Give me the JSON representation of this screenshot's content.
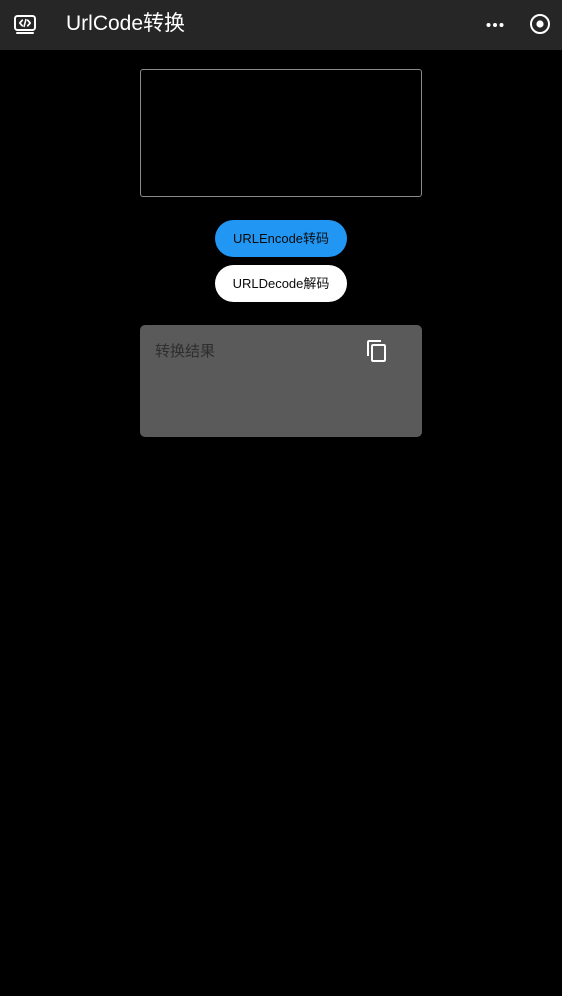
{
  "header": {
    "title": "UrlCode转换",
    "app_icon": "code-window-icon",
    "more_icon": "more-horizontal-icon",
    "target_icon": "radio-target-icon",
    "background_color": "#262626"
  },
  "input": {
    "value": "",
    "placeholder": ""
  },
  "buttons": {
    "encode_label": "URLEncode转码",
    "decode_label": "URLDecode解码",
    "encode_color": "#2196f3",
    "decode_color": "#ffffff"
  },
  "result": {
    "placeholder": "转换结果",
    "copy_icon": "copy-icon",
    "background_color": "#5a5a5a"
  }
}
